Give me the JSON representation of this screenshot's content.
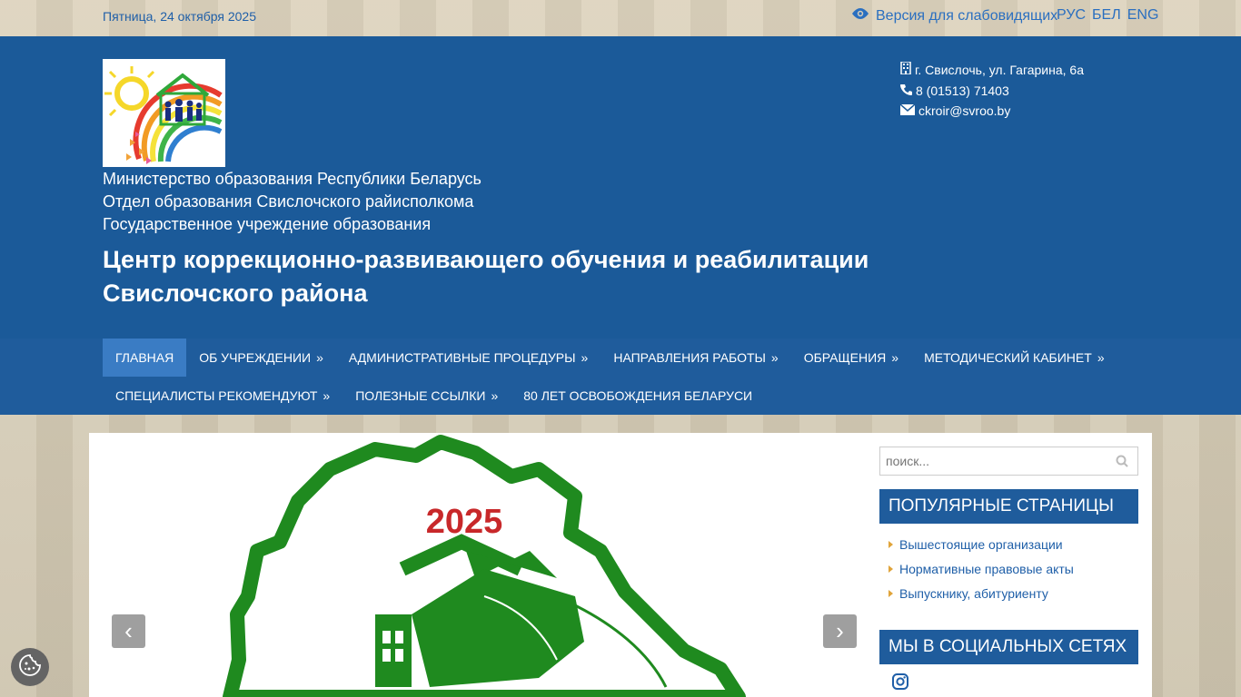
{
  "topbar": {
    "date": "Пятница, 24 октября 2025",
    "vision_label": "Версия для слабовидящих",
    "langs": [
      "РУС",
      "БЕЛ",
      "ENG"
    ]
  },
  "header": {
    "org_lines": [
      "Министерство образования Республики Беларусь",
      "Отдел образования Свислочского райисполкома",
      "Государственное учреждение образования"
    ],
    "title": "Центр коррекционно-развивающего обучения и реабилитации Свислочского района",
    "contacts": {
      "address": "г. Свислочь, ул. Гагарина, 6а",
      "phone": "8 (01513) 71403",
      "email": "ckroir@svroo.by"
    }
  },
  "nav": {
    "items": [
      {
        "label": "Главная",
        "arrow": ""
      },
      {
        "label": "Об учреждении",
        "arrow": "»"
      },
      {
        "label": "Административные процедуры",
        "arrow": "»"
      },
      {
        "label": "Направления работы",
        "arrow": "»"
      },
      {
        "label": "Обращения",
        "arrow": "»"
      },
      {
        "label": "Методический кабинет",
        "arrow": "»"
      },
      {
        "label": "Специалисты рекомендуют",
        "arrow": "»"
      },
      {
        "label": "Полезные ссылки",
        "arrow": "»"
      },
      {
        "label": "80 лет освобождения Беларуси",
        "arrow": ""
      }
    ]
  },
  "slider": {
    "year": "2025",
    "brand_green": "#1f8a1f",
    "year_red": "#c8282a"
  },
  "sidebar": {
    "search_placeholder": "поиск...",
    "popular_title": "ПОПУЛЯРНЫЕ СТРАНИЦЫ",
    "popular_items": [
      "Вышестоящие организации",
      "Нормативные правовые акты",
      "Выпускнику, абитуриенту"
    ],
    "social_title": "МЫ В СОЦИАЛЬНЫХ СЕТЯХ",
    "social_icons": [
      "instagram-icon"
    ]
  },
  "colors": {
    "header_bg": "#1b5a99",
    "nav_bg": "#1f5c9c",
    "nav_active": "#3a7cc4",
    "link": "#1f5fa8",
    "bullet": "#e0a43a"
  }
}
